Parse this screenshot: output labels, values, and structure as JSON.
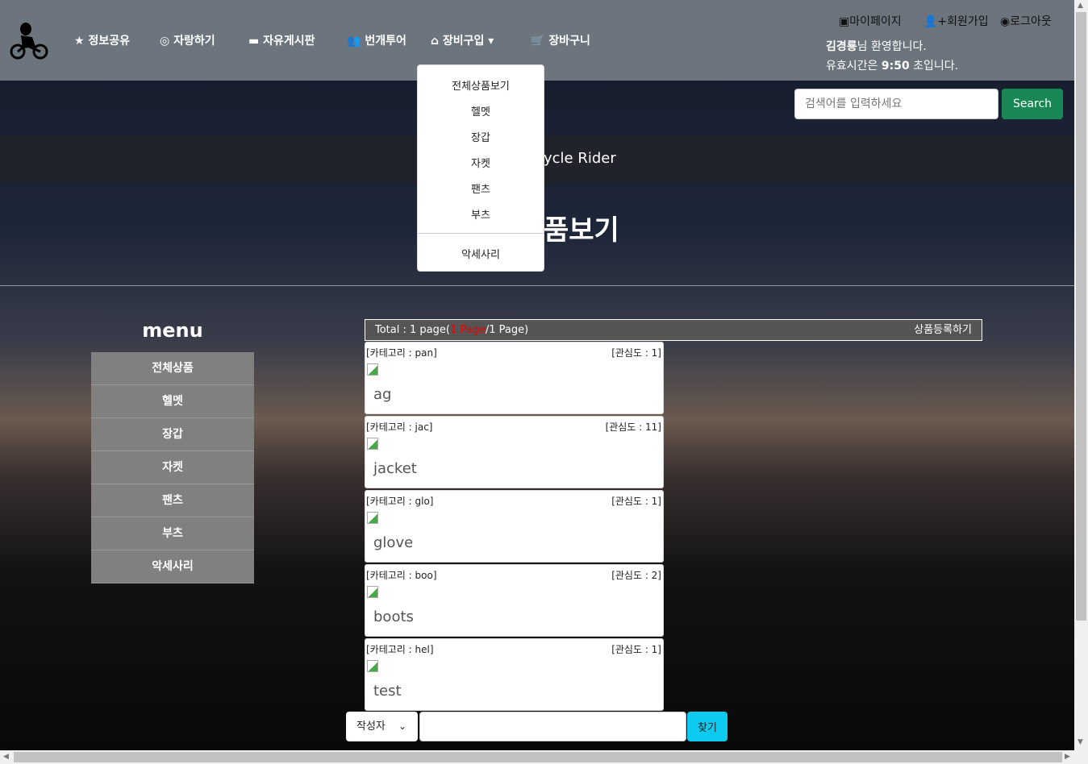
{
  "nav": {
    "items": [
      {
        "label": "정보공유",
        "icon": "star-icon"
      },
      {
        "label": "자랑하기",
        "icon": "instagram-icon"
      },
      {
        "label": "자유게시판",
        "icon": "keyboard-icon"
      },
      {
        "label": "번개투어",
        "icon": "people-icon"
      },
      {
        "label": "장비구입",
        "icon": "shop-icon"
      },
      {
        "label": "장바구니",
        "icon": "cart-icon"
      }
    ],
    "mypage": "마이페이지",
    "signup": "회원가입",
    "logout": "로그아웃",
    "user": "김경룡",
    "welcome_suffix": "님 환영합니다.",
    "timer_prefix": "유효시간은 ",
    "timer": "9:50",
    "timer_suffix": " 초입니다."
  },
  "search": {
    "placeholder": "검색어를 입력하세요",
    "button": "Search"
  },
  "header": {
    "subtitle": "ycle Rider",
    "title": "품보기"
  },
  "dropdown": {
    "items": [
      "전체상품보기",
      "헬멧",
      "장갑",
      "자켓",
      "팬츠",
      "부츠",
      "악세사리"
    ]
  },
  "menu": {
    "title": "menu",
    "items": [
      "전체상품",
      "헬멧",
      "장갑",
      "자켓",
      "팬츠",
      "부츠",
      "악세사리"
    ]
  },
  "list": {
    "total_prefix": "Total : 1 page(",
    "current": "1 Page",
    "total_suffix": "/1 Page)",
    "register": "상품등록하기",
    "products": [
      {
        "category": "[카테고리 : pan]",
        "interest": "[관심도 : 1]",
        "name": "ag"
      },
      {
        "category": "[카테고리 : jac]",
        "interest": "[관심도 : 11]",
        "name": "jacket"
      },
      {
        "category": "[카테고리 : glo]",
        "interest": "[관심도 : 1]",
        "name": "glove"
      },
      {
        "category": "[카테고리 : boo]",
        "interest": "[관심도 : 2]",
        "name": "boots"
      },
      {
        "category": "[카테고리 : hel]",
        "interest": "[관심도 : 1]",
        "name": "test"
      }
    ]
  },
  "bottom_search": {
    "select": "작성자",
    "button": "찾기",
    "value": ""
  }
}
